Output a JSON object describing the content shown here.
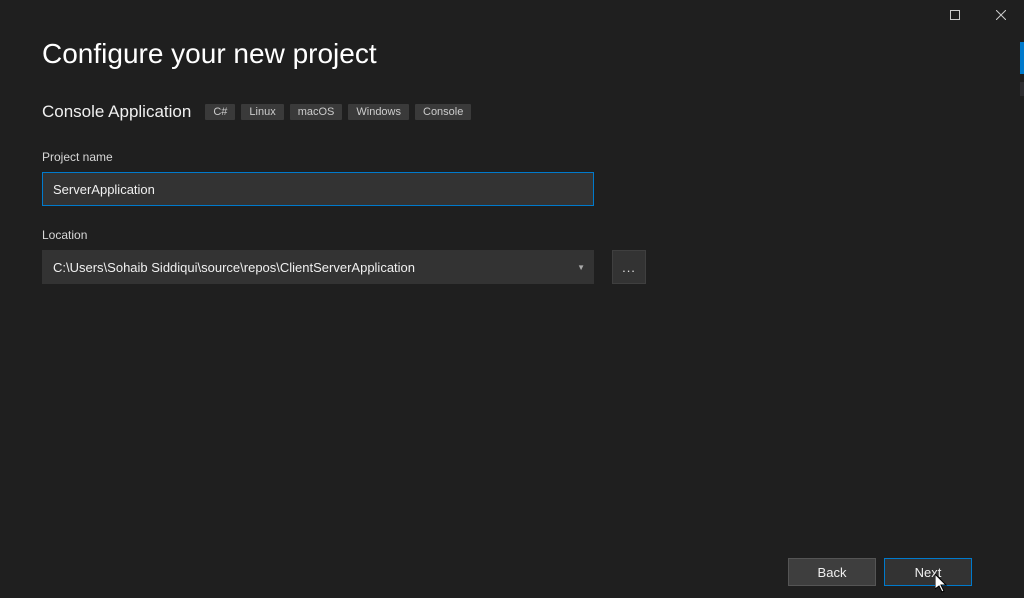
{
  "titlebar": {
    "maximize_tooltip": "Maximize",
    "close_tooltip": "Close"
  },
  "page": {
    "title": "Configure your new project"
  },
  "template": {
    "name": "Console Application",
    "tags": [
      "C#",
      "Linux",
      "macOS",
      "Windows",
      "Console"
    ]
  },
  "fields": {
    "project_name_label": "Project name",
    "project_name_value": "ServerApplication",
    "location_label": "Location",
    "location_value": "C:\\Users\\Sohaib Siddiqui\\source\\repos\\ClientServerApplication",
    "browse_label": "..."
  },
  "buttons": {
    "back": "Back",
    "next": "Next"
  }
}
